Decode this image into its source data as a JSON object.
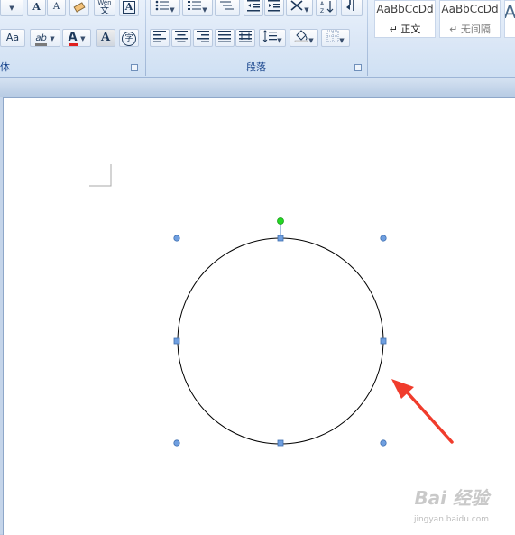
{
  "ribbon": {
    "groups": {
      "font_label_partial": "体",
      "paragraph_label": "段落"
    },
    "font": {
      "grow_font": "A",
      "shrink_font": "A",
      "change_case": "Aa",
      "phonetic_top": "Wén",
      "phonetic_bottom": "文",
      "enclose_char": "字",
      "font_color_letter": "A",
      "char_border_letter": "A",
      "highlight_label": "ab"
    },
    "styles": {
      "items": [
        {
          "sample": "AaBbCcDd",
          "name": "↵ 正文"
        },
        {
          "sample": "AaBbCcDd",
          "name": "↵ 无间隔"
        }
      ],
      "partial_letter": "A"
    }
  },
  "watermark": {
    "text": "Bai 经验",
    "sub": "jingyan.baidu.com"
  },
  "colors": {
    "font_color_underline": "#e02020",
    "rotation_handle": "#23d823",
    "selection_handle": "#4f82c8",
    "arrow": "#f03c2c"
  }
}
